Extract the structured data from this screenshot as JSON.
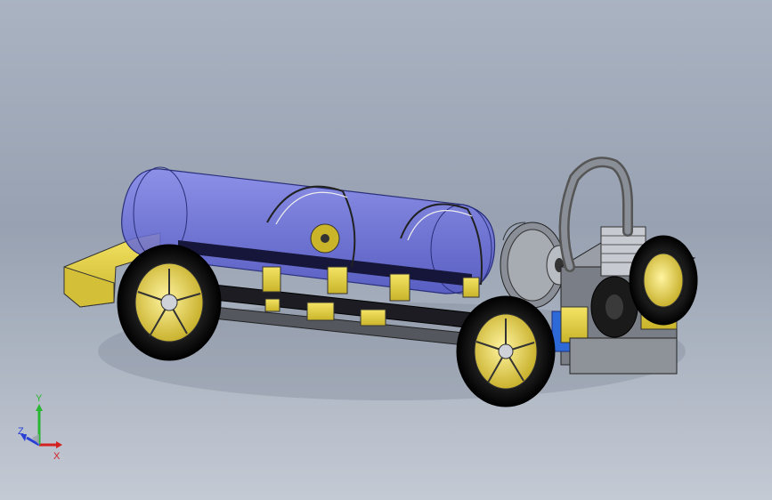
{
  "triad": {
    "x_label": "X",
    "y_label": "Y",
    "z_label": "Z"
  },
  "colors": {
    "background_top": "#aab3c2",
    "background_bottom": "#c4cad4",
    "tank_glass": "#6a6fd8",
    "chassis_yellow": "#e8d64a",
    "tire_black": "#111111",
    "metal_gray": "#8a8e96",
    "axis_x": "#d32020",
    "axis_y": "#2bb534",
    "axis_z": "#2a3fd6"
  }
}
